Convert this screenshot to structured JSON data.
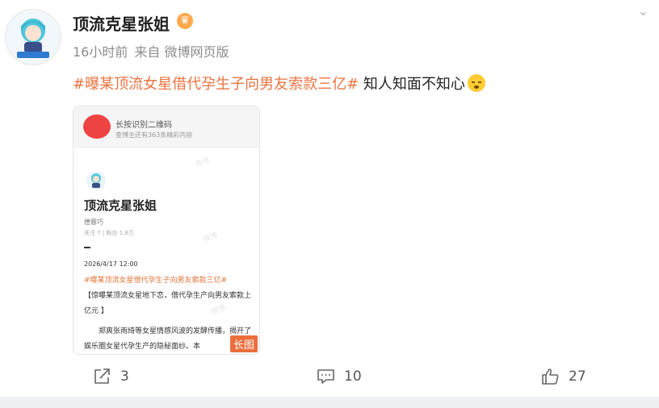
{
  "post": {
    "username": "顶流克星张姐",
    "badge_icon": "crown-icon",
    "time": "16小时前",
    "source": "来自 微博网页版",
    "topic": "#曝某顶流女星借代孕生子向男友索款三亿#",
    "text": " 知人知面不知心",
    "emoji": "upside-down-face-icon"
  },
  "long_image": {
    "qr_title": "长按识别二维码",
    "qr_sub": "查博主还有363条精彩内容",
    "name": "顶流克星张姐",
    "handle": "德蓉巧",
    "stats": "关注 7 | 粉丝 1.8万",
    "dash": "-",
    "date": "2026/4/17 12:00",
    "topic": "#曝某顶流女星借代孕生子向男友索款三亿#",
    "body1": "【惊曝某顶流女星地下恋，借代孕生产向男友索款上亿元 】",
    "body2": "郑爽张雨绮等女星情感风波的发酵传播，揭开了娱乐圈女星代孕生产的隐秘面纱。本",
    "tag": "长图"
  },
  "actions": {
    "share_count": "3",
    "comment_count": "10",
    "like_count": "27"
  },
  "colors": {
    "topic": "#eb7340",
    "long_tag": "#eb6e3c"
  }
}
